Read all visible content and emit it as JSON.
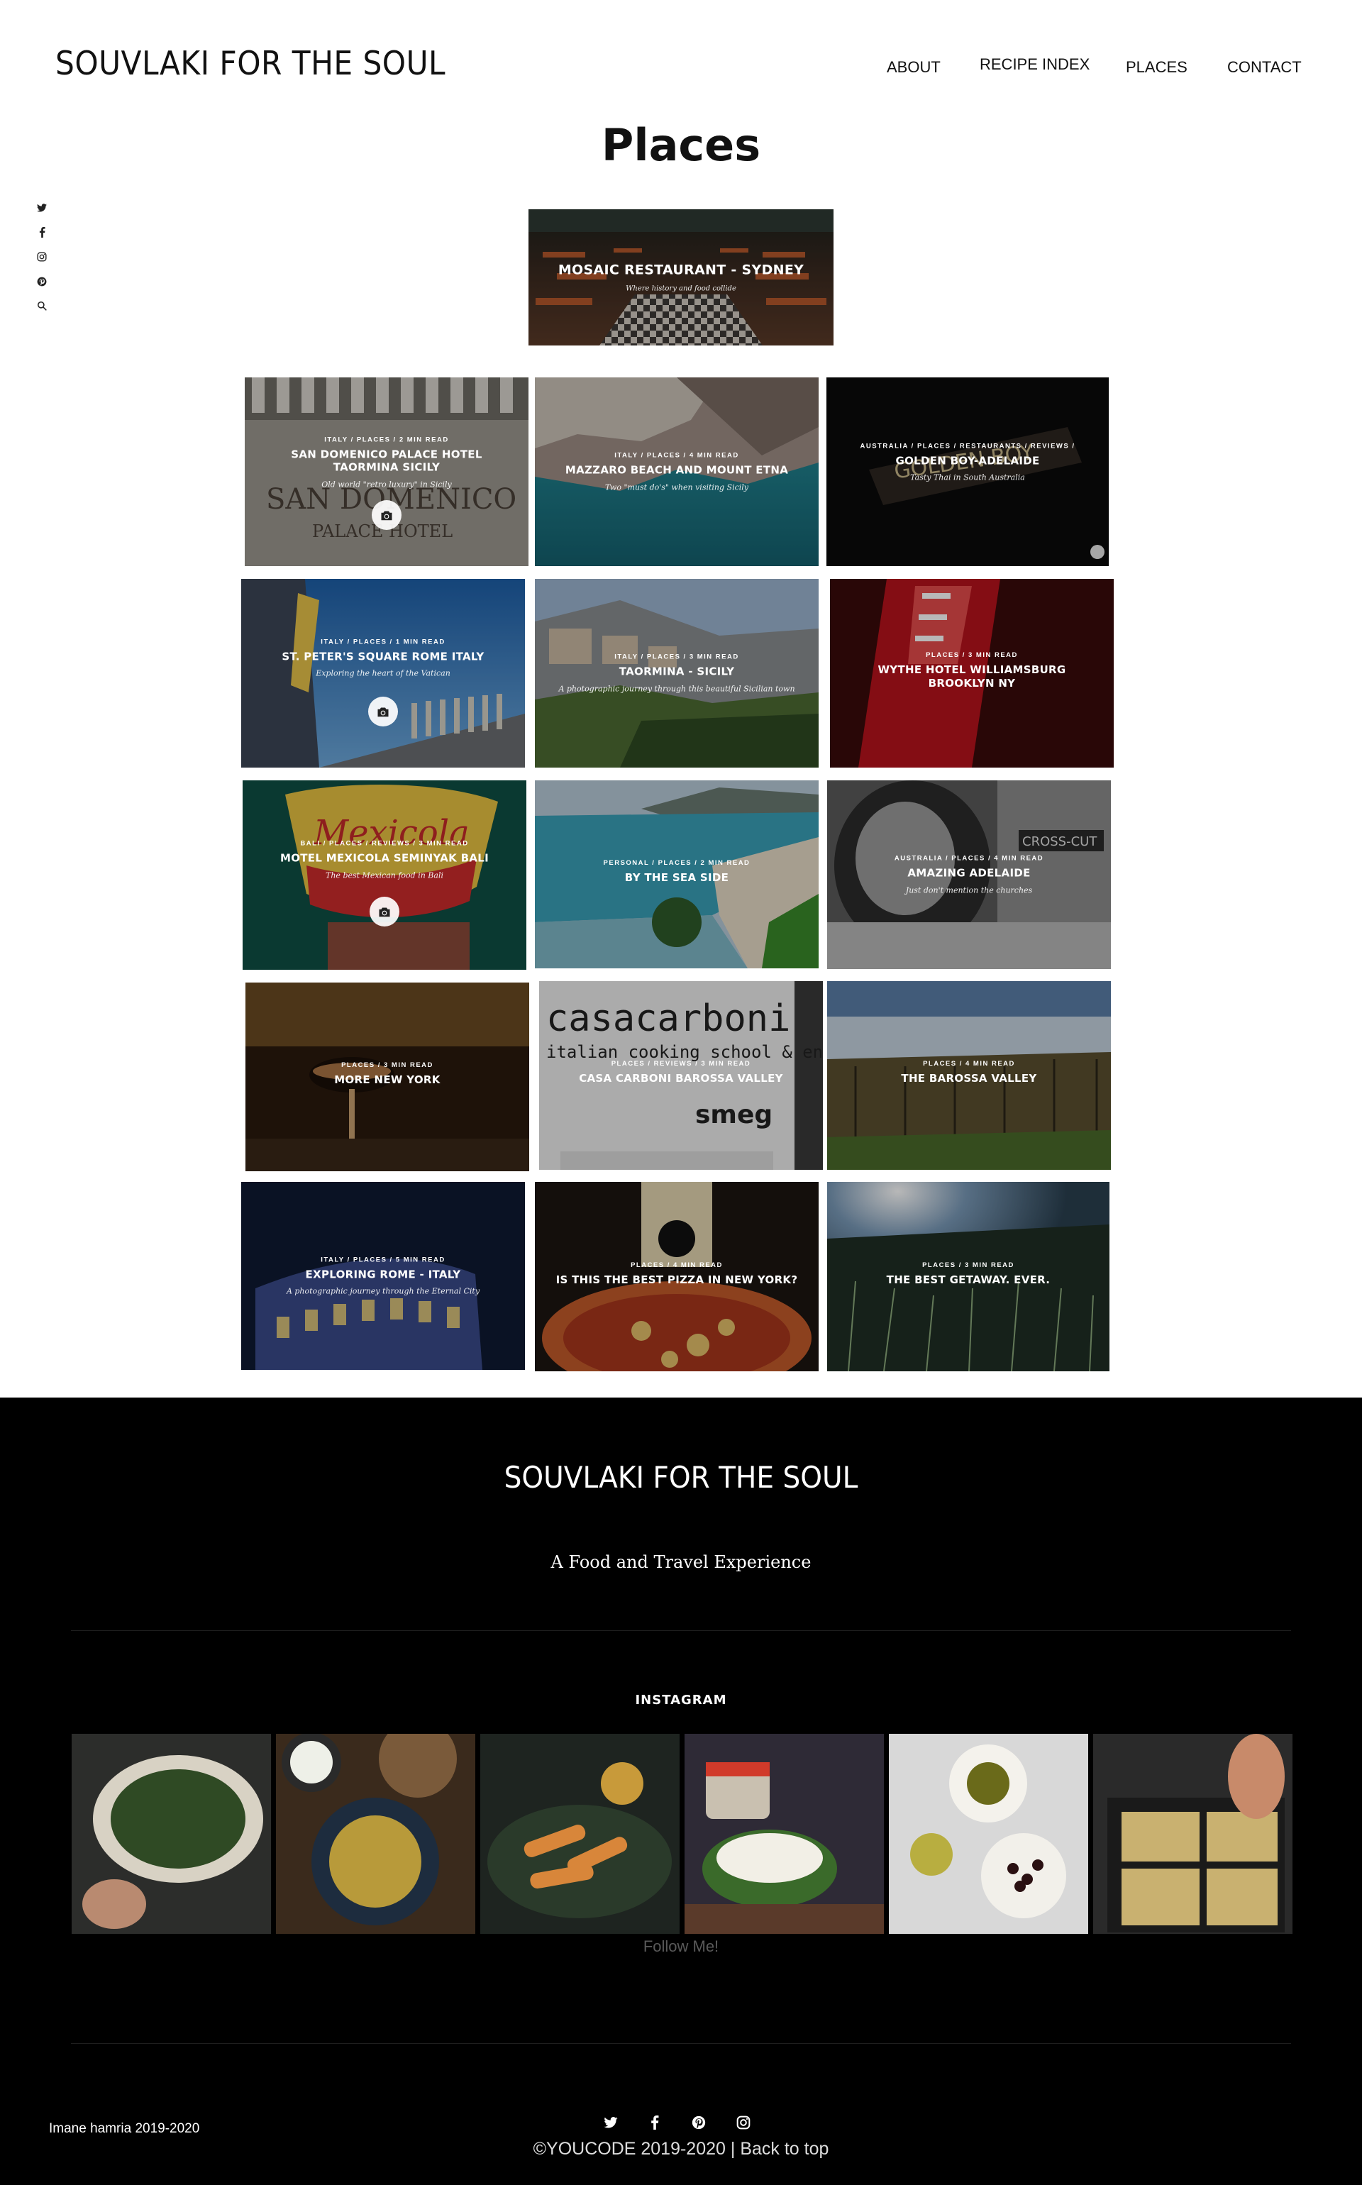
{
  "header": {
    "site_title": "SOUVLAKI FOR THE SOUL",
    "nav": [
      {
        "label": "ABOUT"
      },
      {
        "label": "RECIPE INDEX"
      },
      {
        "label": "PLACES"
      },
      {
        "label": "CONTACT"
      }
    ]
  },
  "page_title": "Places",
  "side_social": [
    "twitter-icon",
    "facebook-icon",
    "instagram-icon",
    "pinterest-icon",
    "search-icon"
  ],
  "featured": {
    "title": "MOSAIC RESTAURANT - SYDNEY",
    "subtitle": "Where history and food collide"
  },
  "posts": [
    {
      "meta": "ITALY  /  PLACES  /  2 MIN READ",
      "title": "SAN DOMENICO PALACE HOTEL TAORMINA SICILY",
      "subtitle": "Old world \"retro luxury\" in Sicily",
      "gallery": true
    },
    {
      "meta": "ITALY  /  PLACES  /  4 MIN READ",
      "title": "MAZZARO BEACH AND MOUNT ETNA",
      "subtitle": "Two \"must do's\" when visiting Sicily",
      "gallery": false
    },
    {
      "meta": "AUSTRALIA  /  PLACES  /  RESTAURANTS  /  REVIEWS  /",
      "title": "GOLDEN BOY-ADELAIDE",
      "subtitle": "Tasty Thai in South Australia",
      "gallery": false
    },
    {
      "meta": "ITALY  /  PLACES  /  1 MIN READ",
      "title": "ST. PETER'S SQUARE ROME ITALY",
      "subtitle": "Exploring the heart of the Vatican",
      "gallery": true
    },
    {
      "meta": "ITALY  /  PLACES  /  3 MIN READ",
      "title": "TAORMINA - SICILY",
      "subtitle": "A photographic journey through this beautiful Sicilian town",
      "gallery": false
    },
    {
      "meta": "PLACES  /  3 MIN READ",
      "title": "WYTHE HOTEL WILLIAMSBURG BROOKLYN NY",
      "subtitle": "",
      "gallery": false
    },
    {
      "meta": "BALI  /  PLACES  /  REVIEWS  /  3 MIN READ",
      "title": "MOTEL MEXICOLA SEMINYAK BALI",
      "subtitle": "The best Mexican food in Bali",
      "gallery": true
    },
    {
      "meta": "PERSONAL  /  PLACES  /  2 MIN READ",
      "title": "BY THE SEA SIDE",
      "subtitle": "",
      "gallery": false
    },
    {
      "meta": "AUSTRALIA  /  PLACES  /  4 MIN READ",
      "title": "AMAZING ADELAIDE",
      "subtitle": "Just don't mention the churches",
      "gallery": false
    },
    {
      "meta": "PLACES  /  3 MIN READ",
      "title": "MORE NEW YORK",
      "subtitle": "",
      "gallery": false
    },
    {
      "meta": "PLACES  /  REVIEWS  /  3 MIN READ",
      "title": "CASA CARBONI BAROSSA VALLEY",
      "subtitle": "",
      "gallery": false
    },
    {
      "meta": "PLACES  /  4 MIN READ",
      "title": "THE BAROSSA VALLEY",
      "subtitle": "",
      "gallery": false
    },
    {
      "meta": "ITALY  /  PLACES  /  5 MIN READ",
      "title": "EXPLORING ROME - ITALY",
      "subtitle": "A photographic journey through the Eternal City",
      "gallery": false
    },
    {
      "meta": "PLACES  /  4 MIN READ",
      "title": "IS THIS THE BEST PIZZA IN NEW YORK?",
      "subtitle": "",
      "gallery": false
    },
    {
      "meta": "PLACES  /  3 MIN READ",
      "title": "THE BEST GETAWAY. EVER.",
      "subtitle": "",
      "gallery": false
    }
  ],
  "footer": {
    "title": "SOUVLAKI FOR THE SOUL",
    "tagline": "A Food and Travel Experience",
    "instagram_heading": "INSTAGRAM",
    "follow_label": "Follow Me!",
    "credit": "Imane hamria 2019-2020",
    "social": [
      "twitter-icon",
      "facebook-icon",
      "pinterest-icon",
      "instagram-icon"
    ],
    "copyright": "©YOUCODE 2019-2020 |",
    "back_to_top": "Back to top"
  }
}
